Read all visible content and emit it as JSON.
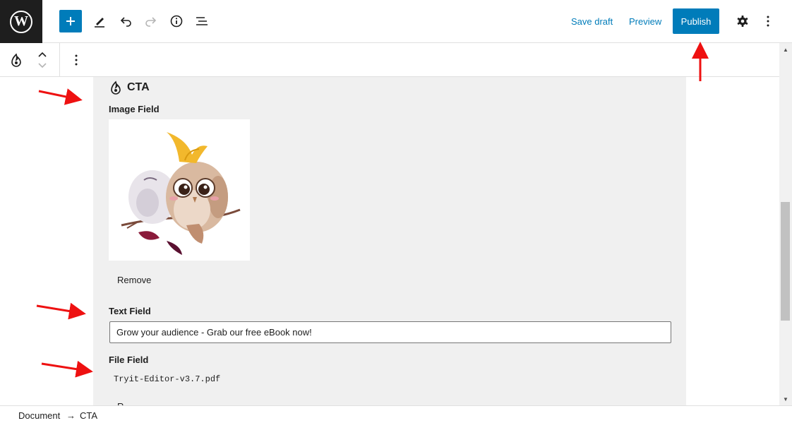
{
  "header": {
    "logo_letter": "W",
    "save_draft_label": "Save draft",
    "preview_label": "Preview",
    "publish_label": "Publish",
    "icons": [
      "wordpress-logo-icon",
      "plus-icon",
      "pencil-icon",
      "undo-icon",
      "redo-icon",
      "info-icon",
      "list-view-icon",
      "gear-icon",
      "more-vertical-icon"
    ]
  },
  "block_toolbar": {
    "icons": [
      "block-type-icon",
      "move-up-icon",
      "move-down-icon",
      "more-vertical-icon"
    ]
  },
  "block": {
    "title": "CTA",
    "image_field": {
      "label": "Image Field",
      "remove_label": "Remove"
    },
    "text_field": {
      "label": "Text Field",
      "value": "Grow your audience - Grab our free eBook now!"
    },
    "file_field": {
      "label": "File Field",
      "file_name": "Tryit-Editor-v3.7.pdf",
      "remove_label_partial": "R"
    }
  },
  "breadcrumb": {
    "root": "Document",
    "separator": "→",
    "current": "CTA"
  },
  "colors": {
    "accent": "#007cba",
    "annotation": "#ee1111",
    "block_bg": "#f0f0f0",
    "logo_bg": "#1e1e1e"
  }
}
